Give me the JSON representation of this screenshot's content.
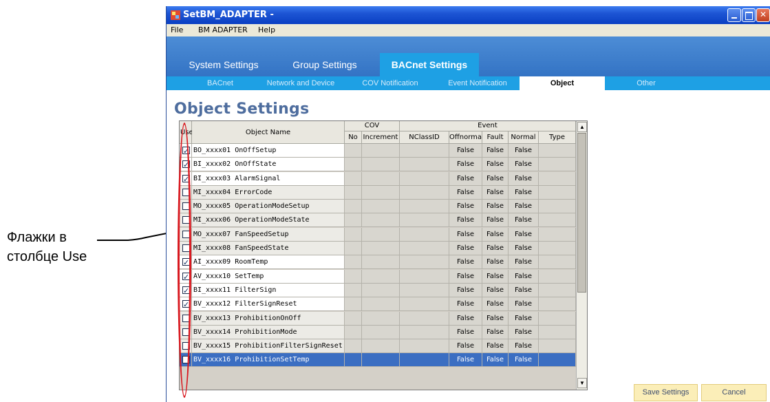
{
  "annotation": {
    "line1": "Флажки в",
    "line2": "столбце Use"
  },
  "window": {
    "title": "SetBM_ADAPTER -"
  },
  "menu": [
    "File",
    "BM ADAPTER",
    "Help"
  ],
  "main_tabs": [
    {
      "label": "System Settings",
      "active": false
    },
    {
      "label": "Group Settings",
      "active": false
    },
    {
      "label": "BACnet Settings",
      "active": true
    }
  ],
  "sub_tabs": [
    {
      "label": "BACnet",
      "active": false
    },
    {
      "label": "Network and Device",
      "active": false
    },
    {
      "label": "COV Notification",
      "active": false
    },
    {
      "label": "Event Notification",
      "active": false
    },
    {
      "label": "Object",
      "active": true
    },
    {
      "label": "Other",
      "active": false
    }
  ],
  "page_title": "Object Settings",
  "grid": {
    "headers": {
      "use": "Use",
      "object_name": "Object Name",
      "cov_group": "COV",
      "event_group": "Event",
      "no": "No",
      "increment": "Increment",
      "nclassid": "NClassID",
      "offnormal": "Offnormal",
      "fault": "Fault",
      "normal": "Normal",
      "type": "Type"
    },
    "rows": [
      {
        "checked": true,
        "name": "BO_xxxx01 OnOffSetup",
        "offnormal": "False",
        "fault": "False",
        "normal": "False"
      },
      {
        "checked": true,
        "name": "BI_xxxx02 OnOffState",
        "offnormal": "False",
        "fault": "False",
        "normal": "False"
      },
      {
        "checked": true,
        "name": "BI_xxxx03 AlarmSignal",
        "offnormal": "False",
        "fault": "False",
        "normal": "False"
      },
      {
        "checked": false,
        "name": "MI_xxxx04 ErrorCode",
        "offnormal": "False",
        "fault": "False",
        "normal": "False"
      },
      {
        "checked": false,
        "name": "MO_xxxx05 OperationModeSetup",
        "offnormal": "False",
        "fault": "False",
        "normal": "False"
      },
      {
        "checked": false,
        "name": "MI_xxxx06 OperationModeState",
        "offnormal": "False",
        "fault": "False",
        "normal": "False"
      },
      {
        "checked": false,
        "name": "MO_xxxx07 FanSpeedSetup",
        "offnormal": "False",
        "fault": "False",
        "normal": "False"
      },
      {
        "checked": false,
        "name": "MI_xxxx08 FanSpeedState",
        "offnormal": "False",
        "fault": "False",
        "normal": "False"
      },
      {
        "checked": true,
        "name": "AI_xxxx09 RoomTemp",
        "offnormal": "False",
        "fault": "False",
        "normal": "False"
      },
      {
        "checked": true,
        "name": "AV_xxxx10 SetTemp",
        "offnormal": "False",
        "fault": "False",
        "normal": "False"
      },
      {
        "checked": true,
        "name": "BI_xxxx11 FilterSign",
        "offnormal": "False",
        "fault": "False",
        "normal": "False"
      },
      {
        "checked": true,
        "name": "BV_xxxx12 FilterSignReset",
        "offnormal": "False",
        "fault": "False",
        "normal": "False"
      },
      {
        "checked": false,
        "name": "BV_xxxx13 ProhibitionOnOff",
        "offnormal": "False",
        "fault": "False",
        "normal": "False"
      },
      {
        "checked": false,
        "name": "BV_xxxx14 ProhibitionMode",
        "offnormal": "False",
        "fault": "False",
        "normal": "False"
      },
      {
        "checked": false,
        "name": "BV_xxxx15 ProhibitionFilterSignReset",
        "offnormal": "False",
        "fault": "False",
        "normal": "False"
      },
      {
        "checked": false,
        "name": "BV_xxxx16 ProhibitionSetTemp",
        "offnormal": "False",
        "fault": "False",
        "normal": "False",
        "selected": true
      }
    ],
    "scroll_up": "▲",
    "scroll_down": "▼"
  },
  "buttons": {
    "save": "Save Settings",
    "cancel": "Cancel"
  },
  "colors": {
    "title_bar": "#1d55d4",
    "tab_band": "#3373c4",
    "active_tab": "#1ea0e4",
    "page_title": "#4e6d9e",
    "selected_row": "#3b6ec2",
    "highlight_oval": "#d9181f",
    "button_fill": "#fbeeb8"
  }
}
